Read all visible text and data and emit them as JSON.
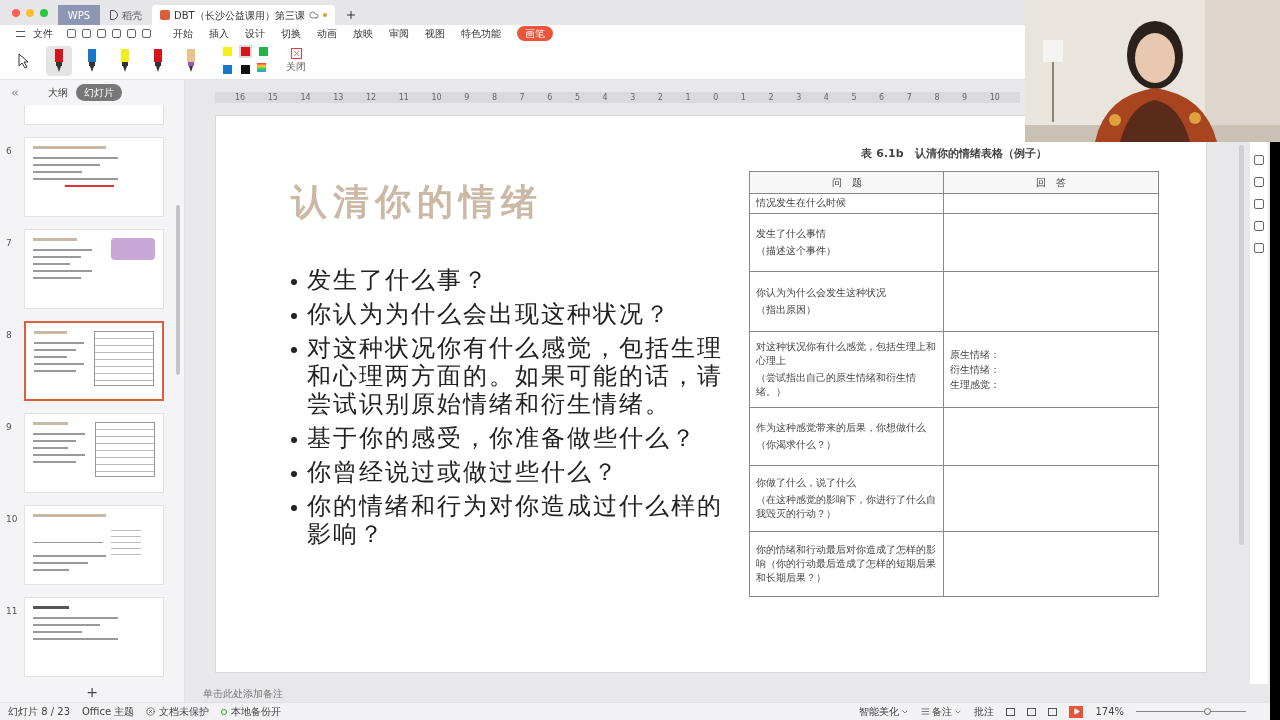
{
  "window_tabs": [
    {
      "label": "WPS",
      "kind": "home",
      "selected": false
    },
    {
      "label": "稻壳",
      "kind": "store",
      "selected": false
    },
    {
      "label": "DBT（长沙公益课用）第三课",
      "kind": "document",
      "selected": true
    }
  ],
  "menu": {
    "file": "文件",
    "items": [
      {
        "label": "开始",
        "selected": false
      },
      {
        "label": "插入",
        "selected": false
      },
      {
        "label": "设计",
        "selected": false
      },
      {
        "label": "切换",
        "selected": false
      },
      {
        "label": "动画",
        "selected": false
      },
      {
        "label": "放映",
        "selected": false
      },
      {
        "label": "审阅",
        "selected": false
      },
      {
        "label": "视图",
        "selected": false
      },
      {
        "label": "特色功能",
        "selected": false
      },
      {
        "label": "画笔",
        "selected": true
      }
    ]
  },
  "pen_toolbar": {
    "pens": [
      {
        "kind": "marker",
        "color": "#d7141c",
        "selected": true
      },
      {
        "kind": "pen",
        "color": "#1b78c8",
        "selected": false
      },
      {
        "kind": "highlighter",
        "color": "#f2ee1a",
        "selected": false
      },
      {
        "kind": "pen",
        "color": "#d7141c",
        "selected": false
      },
      {
        "kind": "eraser",
        "color": "#e8c48a",
        "selected": false
      }
    ],
    "swatches": [
      {
        "color": "#f5f01c",
        "selected": false
      },
      {
        "color": "#d7141c",
        "selected": true
      },
      {
        "color": "#28b04a",
        "selected": false
      },
      {
        "color": "#1b78c8",
        "selected": false
      },
      {
        "color": "#111111",
        "selected": false
      }
    ],
    "close_label": "关闭"
  },
  "panel_tabs": [
    {
      "label": "大纲",
      "selected": false
    },
    {
      "label": "幻灯片",
      "selected": true
    }
  ],
  "thumbnails": [
    {
      "selected": false,
      "kind": "notes"
    },
    {
      "number": "6",
      "selected": false,
      "kind": "notes"
    },
    {
      "number": "7",
      "selected": false
    },
    {
      "number": "8",
      "selected": true,
      "kind": "table"
    },
    {
      "number": "9",
      "selected": false,
      "kind": "table"
    },
    {
      "number": "10",
      "selected": false,
      "kind": "diagram"
    },
    {
      "number": "11",
      "selected": false,
      "kind": "lines"
    }
  ],
  "add_slide": "+",
  "ruler": [
    "16",
    "15",
    "14",
    "13",
    "12",
    "11",
    "10",
    "9",
    "8",
    "7",
    "6",
    "5",
    "4",
    "3",
    "2",
    "1",
    "0",
    "1",
    "2",
    "3",
    "4",
    "5",
    "6",
    "7",
    "8",
    "9",
    "10"
  ],
  "slide": {
    "title": "认清你的情绪",
    "bullets": [
      "发生了什么事？",
      "你认为为什么会出现这种状况？",
      "对这种状况你有什么感觉，包括生理和心理两方面的。如果可能的话，请尝试识别原始情绪和衍生情绪。",
      "基于你的感受，你准备做些什么？",
      "你曾经说过或做过些什么？",
      "你的情绪和行为对你造成过什么样的影响？"
    ],
    "table": {
      "caption": "表 6.1b　认清你的情绪表格（例子）",
      "columns": [
        "问　题",
        "回　答"
      ],
      "rows": [
        {
          "question": [
            "情况发生在什么时候"
          ],
          "answer": []
        },
        {
          "question": [
            "发生了什么事情",
            "（描述这个事件）"
          ],
          "answer": []
        },
        {
          "question": [
            "你认为为什么会发生这种状况",
            "（指出原因）"
          ],
          "answer": []
        },
        {
          "question": [
            "对这种状况你有什么感觉，包括生理上和心理上",
            "（尝试指出自己的原生情绪和衍生情绪。）"
          ],
          "answer": [
            "原生情绪：",
            "衍生情绪：",
            "生理感觉："
          ]
        },
        {
          "question": [
            "作为这种感觉带来的后果，你想做什么",
            "（你渴求什么？）"
          ],
          "answer": []
        },
        {
          "question": [
            "你做了什么，说了什么",
            "（在这种感觉的影响下，你进行了什么自我毁灭的行动？）"
          ],
          "answer": []
        },
        {
          "question": [
            "你的情绪和行动最后对你造成了怎样的影响（你的行动最后造成了怎样的短期后果和长期后果？）"
          ],
          "answer": []
        }
      ]
    }
  },
  "notes_placeholder": "单击此处添加备注",
  "status_bar": {
    "slide_counter": "幻灯片 8 / 23",
    "theme": "Office 主题",
    "protection": "文档未保护",
    "backup": "本地备份开",
    "beautify": "智能美化",
    "notes": "备注",
    "comments": "批注",
    "zoom": "174%",
    "zoom_slider": {
      "level": 0.62
    }
  }
}
